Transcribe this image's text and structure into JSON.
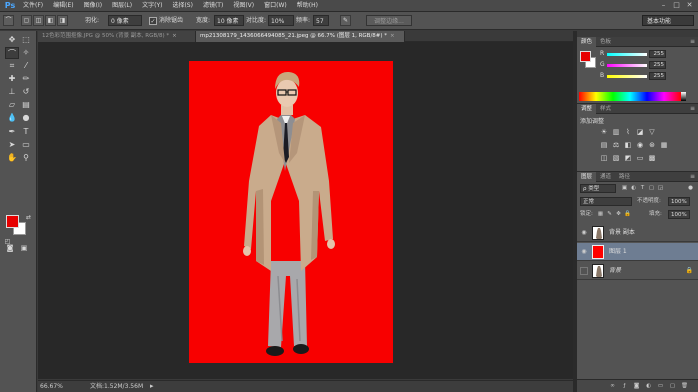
{
  "app": {
    "logo": "Ps"
  },
  "menubar": {
    "items": [
      "文件(F)",
      "编辑(E)",
      "图像(I)",
      "图层(L)",
      "文字(Y)",
      "选择(S)",
      "滤镜(T)",
      "视图(V)",
      "窗口(W)",
      "帮助(H)"
    ],
    "window_controls": [
      "–",
      "□",
      "✕"
    ]
  },
  "options_bar": {
    "feather_label": "羽化:",
    "feather_value": "0 像素",
    "antialias_label": "消除锯齿",
    "width_label": "宽度:",
    "width_value": "10 像素",
    "contrast_label": "对比度:",
    "contrast_value": "10%",
    "frequency_label": "频率:",
    "frequency_value": "57",
    "refine_edge_label": "调整边缘...",
    "workspace_label": "基本功能"
  },
  "tabs": [
    {
      "label": "12色彩范围抠像.JPG @ 50% (背景 副本, RGB/8) *",
      "active": false
    },
    {
      "label": "mp21308179_1436066494085_21.jpeg @ 66.7% (图层 1, RGB/8#) *",
      "active": true
    }
  ],
  "tab_close": "×",
  "statusbar": {
    "zoom": "66.67%",
    "doc_info": "文档:1.52M/3.56M"
  },
  "colors": {
    "foreground": "#e60000",
    "background": "#ffffff",
    "canvas_fill": "#f80000",
    "selected_layer": "#6e7d92"
  },
  "color_panel": {
    "tabs": [
      "颜色",
      "色板"
    ],
    "r_label": "R",
    "r_value": "255",
    "g_label": "G",
    "g_value": "255",
    "b_label": "B",
    "b_value": "255"
  },
  "adjustments_panel": {
    "tabs": [
      "调整",
      "样式"
    ],
    "title": "添加调整"
  },
  "layers_panel": {
    "tabs": [
      "图层",
      "通道",
      "路径"
    ],
    "filter_label": "ρ 类型",
    "blend_mode": "正常",
    "opacity_label": "不透明度:",
    "opacity_value": "100%",
    "lock_label": "锁定:",
    "fill_label": "填充:",
    "fill_value": "100%",
    "layers": [
      {
        "name": "背景 副本",
        "visible": true,
        "selected": false,
        "locked": false
      },
      {
        "name": "图层 1",
        "visible": true,
        "selected": true,
        "locked": false
      },
      {
        "name": "背景",
        "visible": false,
        "selected": false,
        "locked": true
      }
    ]
  },
  "icons": {
    "eye": "eye-icon",
    "lock": "lock-icon",
    "panel_menu": "panel-menu-icon"
  }
}
